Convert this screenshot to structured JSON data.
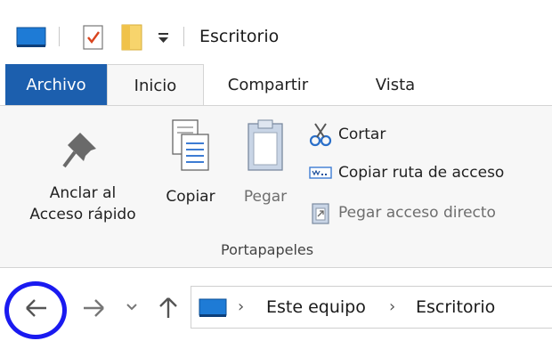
{
  "window": {
    "title": "Escritorio"
  },
  "tabs": {
    "archivo": "Archivo",
    "inicio": "Inicio",
    "compartir": "Compartir",
    "vista": "Vista"
  },
  "ribbon": {
    "pin": {
      "line1": "Anclar al",
      "line2": "Acceso rápido"
    },
    "copy": "Copiar",
    "paste": "Pegar",
    "cut": "Cortar",
    "copy_path": "Copiar ruta de acceso",
    "paste_shortcut": "Pegar acceso directo",
    "group": "Portapapeles"
  },
  "address": {
    "crumbs": [
      "Este equipo",
      "Escritorio"
    ]
  },
  "colors": {
    "archivo_tab": "#1c5fae",
    "highlight_circle": "#1a1af0"
  },
  "icons": [
    "monitor-icon",
    "properties-check-icon",
    "folder-icon",
    "dropdown-arrow-icon",
    "pin-icon",
    "copy-icon",
    "paste-icon",
    "scissors-icon",
    "copy-path-icon",
    "paste-shortcut-icon",
    "back-arrow-icon",
    "forward-arrow-icon",
    "recent-chevron-icon",
    "up-arrow-icon",
    "breadcrumb-chevron-icon"
  ]
}
